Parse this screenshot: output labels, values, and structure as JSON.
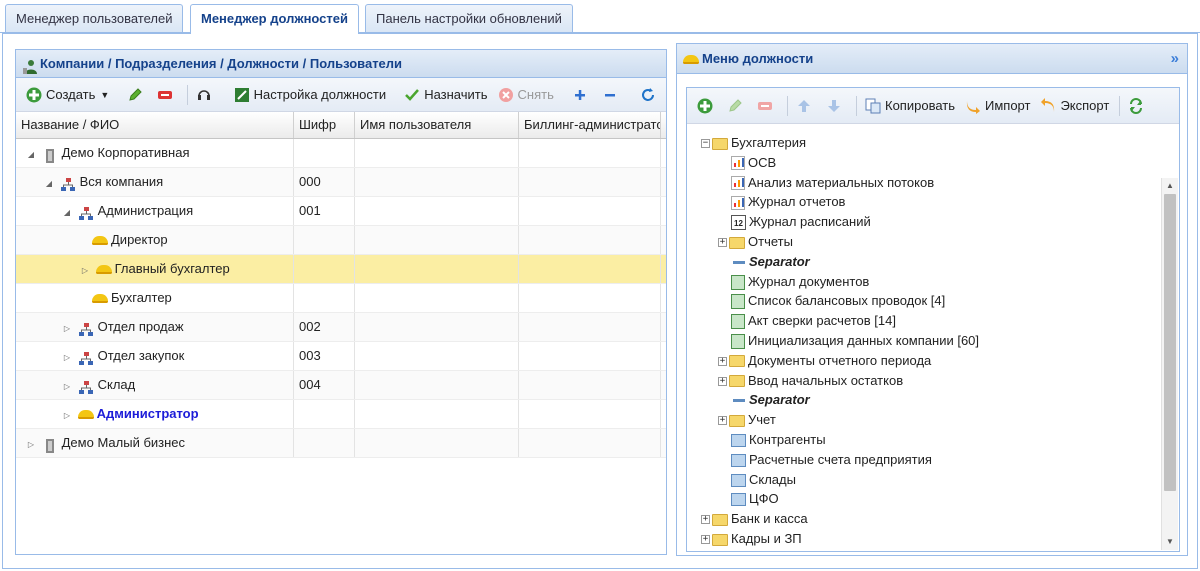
{
  "tabs": [
    "Менеджер пользователей",
    "Менеджер должностей",
    "Панель настройки обновлений"
  ],
  "left_panel": {
    "title": "Компании / Подразделения / Должности / Пользователи",
    "toolbar": {
      "create": "Создать",
      "position_settings": "Настройка должности",
      "assign": "Назначить",
      "remove": "Снять"
    },
    "columns": [
      "Название / ФИО",
      "Шифр",
      "Имя пользователя",
      "Биллинг-администратор"
    ],
    "rows": [
      {
        "name": "Демо Корпоративная",
        "code": ""
      },
      {
        "name": "Вся компания",
        "code": "000"
      },
      {
        "name": "Администрация",
        "code": "001"
      },
      {
        "name": "Директор",
        "code": ""
      },
      {
        "name": "Главный бухгалтер",
        "code": ""
      },
      {
        "name": "Бухгалтер",
        "code": ""
      },
      {
        "name": "Отдел продаж",
        "code": "002"
      },
      {
        "name": "Отдел закупок",
        "code": "003"
      },
      {
        "name": "Склад",
        "code": "004"
      },
      {
        "name": "Администратор",
        "code": ""
      },
      {
        "name": "Демо Малый бизнес",
        "code": ""
      }
    ]
  },
  "right_panel": {
    "title": "Меню должности",
    "toolbar": {
      "copy": "Копировать",
      "import": "Импорт",
      "export": "Экспорт"
    },
    "tree": [
      "Бухгалтерия",
      "ОСВ",
      "Анализ материальных потоков",
      "Журнал отчетов",
      "Журнал расписаний",
      "Отчеты",
      "Separator",
      "Журнал документов",
      "Список балансовых проводок [4]",
      "Акт сверки расчетов [14]",
      "Инициализация данных компании [60]",
      "Документы отчетного периода",
      "Ввод начальных остатков",
      "Separator",
      "Учет",
      "Контрагенты",
      "Расчетные счета предприятия",
      "Склады",
      "ЦФО",
      "Банк и касса",
      "Кадры и ЗП"
    ],
    "calendar_icon_text": "12"
  },
  "colors": {
    "border": "#99bbe8",
    "header_text": "#15428b",
    "selected_row": "#fbeea3",
    "highlight_link": "#1c1cd8"
  }
}
